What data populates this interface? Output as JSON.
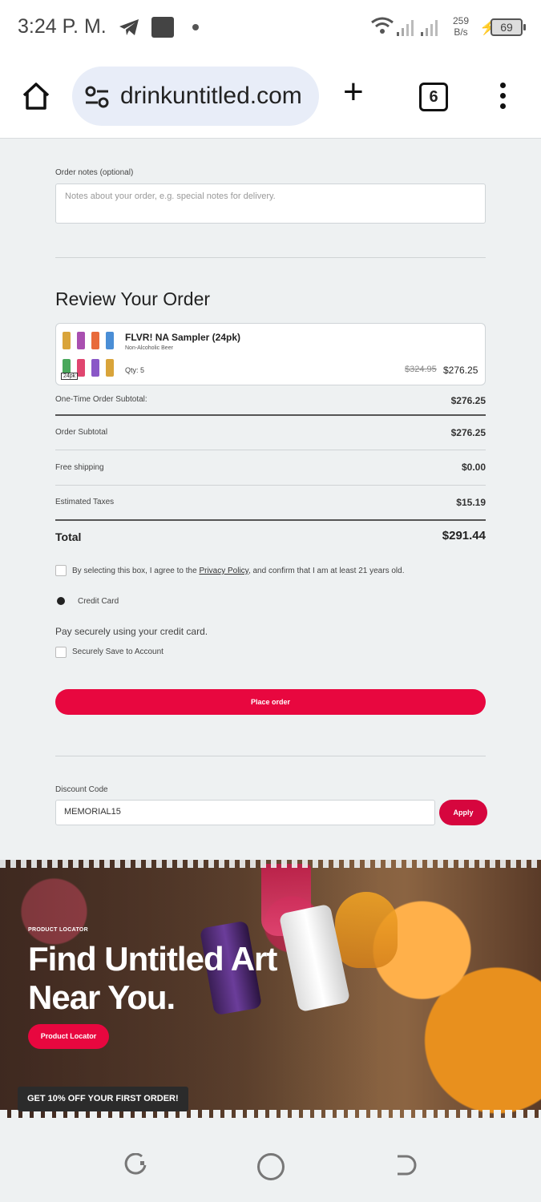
{
  "status_bar": {
    "time": "3:24 P. M.",
    "net_speed_value": "259",
    "net_speed_unit": "B/s",
    "battery": "69"
  },
  "browser": {
    "url": "drinkuntitled.com",
    "tab_count": "6"
  },
  "order_notes": {
    "label": "Order notes (optional)",
    "placeholder": "Notes about your order, e.g. special notes for delivery."
  },
  "review": {
    "title": "Review Your Order",
    "product": {
      "name": "FLVR! NA Sampler (24pk)",
      "subtitle": "Non-Alcoholic Beer",
      "qty": "Qty: 5",
      "badge": "24pk",
      "original_price": "$324.95",
      "price": "$276.25"
    }
  },
  "summary": {
    "one_time_label": "One-Time Order Subtotal:",
    "one_time_value": "$276.25",
    "subtotal_label": "Order Subtotal",
    "subtotal_value": "$276.25",
    "shipping_label": "Free shipping",
    "shipping_value": "$0.00",
    "taxes_label": "Estimated Taxes",
    "taxes_value": "$15.19",
    "total_label": "Total",
    "total_value": "$291.44"
  },
  "agreement": {
    "prefix": "By selecting this box, I agree to the ",
    "link": "Privacy Policy",
    "suffix": ", and confirm that I am at least 21 years old."
  },
  "payment": {
    "method": "Credit Card",
    "description": "Pay securely using your credit card.",
    "save_label": "Securely Save to Account",
    "place_order": "Place order"
  },
  "discount": {
    "label": "Discount Code",
    "value": "MEMORIAL15",
    "apply": "Apply"
  },
  "banner": {
    "kicker": "PRODUCT LOCATOR",
    "title": "Find Untitled Art\nNear You.",
    "button": "Product Locator",
    "promo": "GET 10% OFF YOUR FIRST ORDER!"
  }
}
